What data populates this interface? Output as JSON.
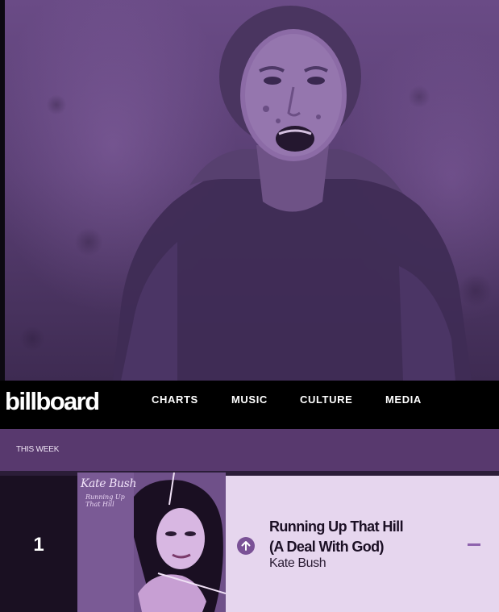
{
  "navbar": {
    "logo_text": "billboard",
    "items": [
      "CHARTS",
      "MUSIC",
      "CULTURE",
      "MEDIA"
    ]
  },
  "chart": {
    "section_label": "THIS WEEK",
    "entries": [
      {
        "rank": "1",
        "trend": "up-arrow-icon",
        "title_line1": "Running Up That Hill",
        "title_line2": "(A Deal With God)",
        "artist": "Kate Bush",
        "last_week": "–",
        "cover_artist": "Kate Bush",
        "cover_title": "Running Up That Hill"
      }
    ]
  },
  "colors": {
    "hero_tint": "#5a3f74",
    "week_bar": "#58396e",
    "row_background": "#e6d6ee",
    "rank_background": "#1a1022",
    "accent": "#7a5196"
  }
}
